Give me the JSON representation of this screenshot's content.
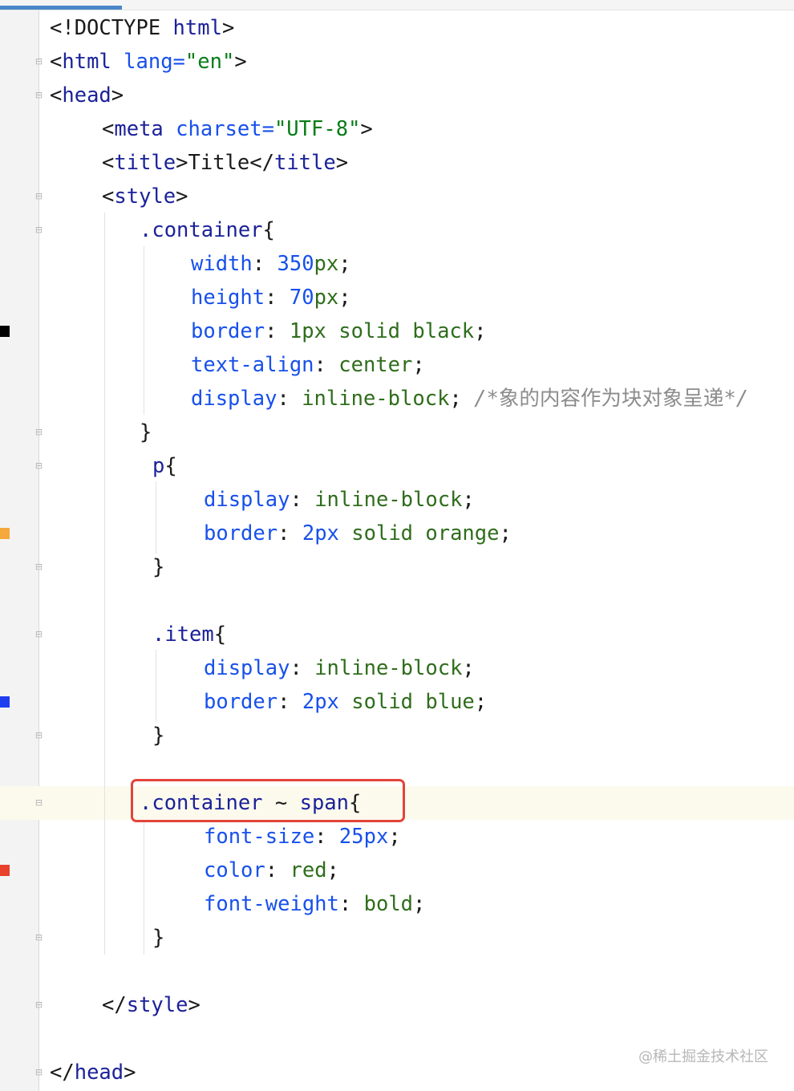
{
  "editor": {
    "lines": [
      {
        "tokens": [
          "<!DOCTYPE ",
          "html",
          ">"
        ]
      },
      {
        "tokens": [
          "<",
          "html",
          " lang=",
          "\"en\"",
          ">"
        ]
      },
      {
        "tokens": [
          "<",
          "head",
          ">"
        ]
      },
      {
        "tokens": [
          "<",
          "meta",
          " charset=",
          "\"UTF-8\"",
          ">"
        ]
      },
      {
        "tokens": [
          "<",
          "title",
          ">",
          "Title",
          "</",
          "title",
          ">"
        ]
      },
      {
        "tokens": [
          "<",
          "style",
          ">"
        ]
      },
      {
        "tokens": [
          ".container",
          "{"
        ]
      },
      {
        "tokens": [
          "width",
          ": ",
          "350",
          "px",
          ";"
        ]
      },
      {
        "tokens": [
          "height",
          ": ",
          "70",
          "px",
          ";"
        ]
      },
      {
        "tokens": [
          "border",
          ": ",
          "1px",
          " solid black",
          ";"
        ]
      },
      {
        "tokens": [
          "text-align",
          ": ",
          "center",
          ";"
        ]
      },
      {
        "tokens": [
          "display",
          ": ",
          "inline-block",
          "; ",
          "/*",
          "象的内容作为块对象呈递",
          "*/"
        ]
      },
      {
        "tokens": [
          "}"
        ]
      },
      {
        "tokens": [
          "p",
          "{"
        ]
      },
      {
        "tokens": [
          "display",
          ": ",
          "inline-block",
          ";"
        ]
      },
      {
        "tokens": [
          "border",
          ": ",
          "2px",
          " solid orange",
          ";"
        ]
      },
      {
        "tokens": [
          "}"
        ]
      },
      {
        "tokens": [
          ".item",
          "{"
        ]
      },
      {
        "tokens": [
          "display",
          ": ",
          "inline-block",
          ";"
        ]
      },
      {
        "tokens": [
          "border",
          ": ",
          "2px",
          " solid blue",
          ";"
        ]
      },
      {
        "tokens": [
          "}"
        ]
      },
      {
        "tokens": [
          ".container",
          " ~ ",
          "span",
          "{"
        ]
      },
      {
        "tokens": [
          "font-size",
          ": ",
          "25px",
          ";"
        ]
      },
      {
        "tokens": [
          "color",
          ": ",
          "red",
          ";"
        ]
      },
      {
        "tokens": [
          "font-weight",
          ": ",
          "bold",
          ";"
        ]
      },
      {
        "tokens": [
          "}"
        ]
      },
      {
        "tokens": [
          "</",
          "style",
          ">"
        ]
      },
      {
        "tokens": [
          "</",
          "head",
          ">"
        ]
      }
    ],
    "gutter_swatches": {
      "black": "#000000",
      "orange": "#f5a83c",
      "blue": "#1f3ef0",
      "red": "#e8412c"
    },
    "highlight_color": "#e2443a"
  },
  "watermark": "@稀土掘金技术社区"
}
